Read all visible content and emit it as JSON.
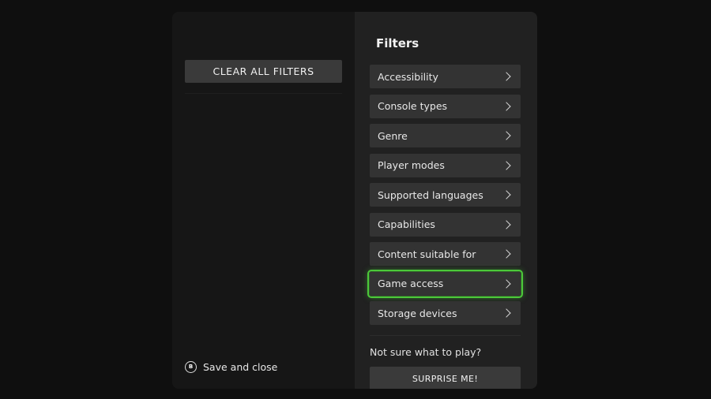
{
  "left_pane": {
    "clear_all_label": "CLEAR ALL FILTERS",
    "save_close": {
      "button_glyph": "B",
      "label": "Save and close"
    }
  },
  "right_pane": {
    "title": "Filters",
    "filters": [
      {
        "label": "Accessibility"
      },
      {
        "label": "Console types"
      },
      {
        "label": "Genre"
      },
      {
        "label": "Player modes"
      },
      {
        "label": "Supported languages"
      },
      {
        "label": "Capabilities"
      },
      {
        "label": "Content suitable for"
      },
      {
        "label": "Game access",
        "focused": true
      },
      {
        "label": "Storage devices"
      }
    ],
    "prompt": "Not sure what to play?",
    "surprise_label": "SURPRISE ME!"
  },
  "colors": {
    "focus_ring": "#4cc83a",
    "background": "#0f0f0f",
    "panel_right": "#212121",
    "item": "#333333"
  },
  "icons": {
    "chevron": "chevron-right-icon",
    "controller_button": "b-button-icon"
  }
}
